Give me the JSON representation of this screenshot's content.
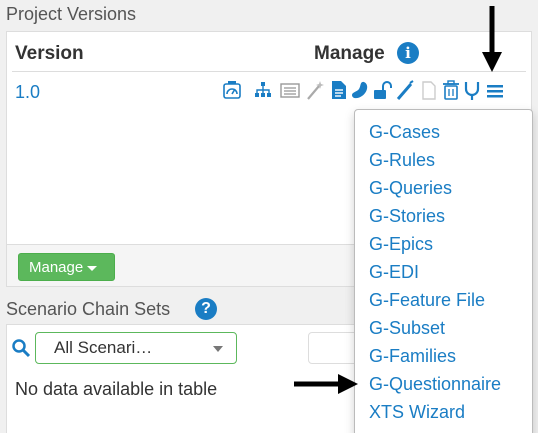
{
  "project_versions": {
    "title": "Project Versions",
    "col_version": "Version",
    "col_manage": "Manage",
    "info_icon": "i",
    "row_version": "1.0",
    "manage_button": "Manage"
  },
  "toolbar_icons": [
    "dashboard-icon",
    "sitemap-icon",
    "list-card-icon",
    "magic-wand-icon",
    "file-icon",
    "bean-icon",
    "unlock-icon",
    "pencil-icon",
    "blank-file-icon",
    "trash-icon",
    "fork-icon",
    "menu-bars-icon"
  ],
  "dropdown_menu": {
    "items": [
      "G-Cases",
      "G-Rules",
      "G-Queries",
      "G-Stories",
      "G-Epics",
      "G-EDI",
      "G-Feature File",
      "G-Subset",
      "G-Families",
      "G-Questionnaire",
      "XTS Wizard"
    ]
  },
  "scenario_chain_sets": {
    "title": "Scenario Chain Sets",
    "help_icon": "?",
    "select_value": "All Scenari…",
    "empty_message": "No data available in table"
  },
  "colors": {
    "link_blue": "#1a7dc4",
    "green": "#5cb85c",
    "background": "#f0f0f0"
  }
}
